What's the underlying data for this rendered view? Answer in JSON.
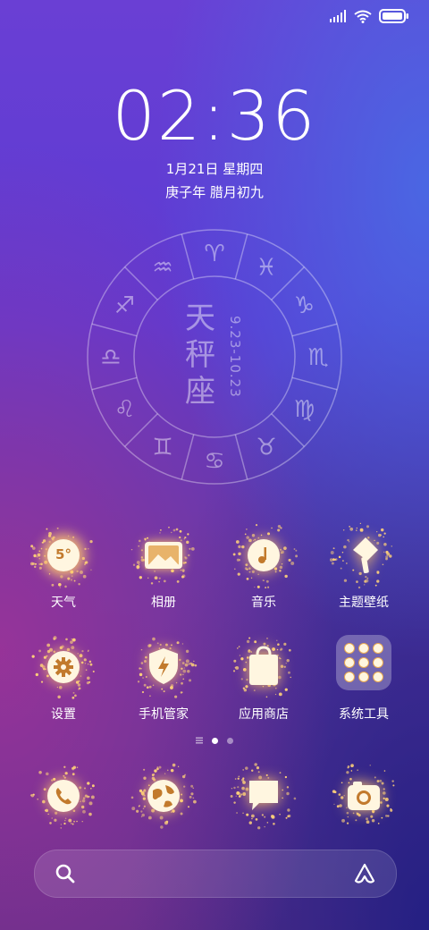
{
  "status_bar": {
    "signal_icon": "signal-icon",
    "wifi_icon": "wifi-icon",
    "battery_icon": "battery-icon"
  },
  "clock": {
    "time": "02:36",
    "date": "1月21日 星期四",
    "lunar": "庚子年 腊月初九"
  },
  "zodiac_widget": {
    "name_chars": [
      "天",
      "秤",
      "座"
    ],
    "date_range": "9.23-10.23",
    "signs": [
      "♈",
      "♓",
      "♑",
      "♏",
      "♍",
      "♉",
      "♋",
      "♊",
      "♌",
      "♎",
      "♐",
      "♒"
    ]
  },
  "apps_row1": [
    {
      "label": "天气",
      "icon": "weather-icon",
      "badge": "5°"
    },
    {
      "label": "相册",
      "icon": "gallery-icon"
    },
    {
      "label": "音乐",
      "icon": "music-icon"
    },
    {
      "label": "主题壁纸",
      "icon": "theme-brush-icon"
    }
  ],
  "apps_row2": [
    {
      "label": "设置",
      "icon": "gear-icon"
    },
    {
      "label": "手机管家",
      "icon": "security-shield-icon"
    },
    {
      "label": "应用商店",
      "icon": "shopping-bag-icon"
    },
    {
      "label": "系统工具",
      "icon": "folder-icon"
    }
  ],
  "dock": [
    {
      "icon": "phone-icon"
    },
    {
      "icon": "browser-globe-icon"
    },
    {
      "icon": "message-icon"
    },
    {
      "icon": "camera-icon"
    }
  ],
  "page_indicator": {
    "current": 2,
    "total": 3
  },
  "search_bar": {
    "search_icon": "search-icon",
    "assistant_icon": "assistant-icon"
  },
  "colors": {
    "glow": "#ffd27a",
    "icon_fill": "#fff6e0"
  }
}
